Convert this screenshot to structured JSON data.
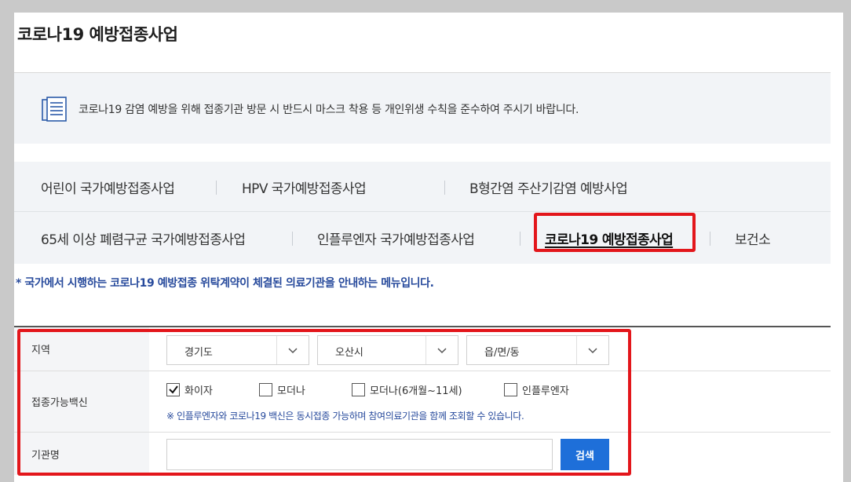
{
  "page": {
    "title": "코로나19 예방접종사업"
  },
  "notice": {
    "icon": "document-list-icon",
    "text": "코로나19 감염 예방을 위해 접종기관 방문 시 반드시 마스크 착용 등 개인위생 수칙을 준수하여 주시기 바랍니다."
  },
  "tabs": {
    "row1": [
      {
        "label": "어린이 국가예방접종사업"
      },
      {
        "label": "HPV 국가예방접종사업"
      },
      {
        "label": "B형간염 주산기감염 예방사업"
      }
    ],
    "row2": [
      {
        "label": "65세 이상 폐렴구균 국가예방접종사업"
      },
      {
        "label": "인플루엔자 국가예방접종사업"
      },
      {
        "label": "코로나19 예방접종사업",
        "active": true
      },
      {
        "label": "보건소"
      }
    ]
  },
  "info_line": "* 국가에서 시행하는 코로나19 예방접종 위탁계약이 체결된 의료기관을 안내하는 메뉴입니다.",
  "form": {
    "region": {
      "label": "지역",
      "province": "경기도",
      "city": "오산시",
      "town": "읍/면/동"
    },
    "vaccine": {
      "label": "접종가능백신",
      "options": [
        {
          "label": "화이자",
          "checked": true
        },
        {
          "label": "모더나",
          "checked": false
        },
        {
          "label": "모더나(6개월~11세)",
          "checked": false
        },
        {
          "label": "인플루엔자",
          "checked": false
        }
      ],
      "note": "※ 인플루엔자와 코로나19 백신은 동시접종 가능하며 참여의료기관을 함께 조회할 수 있습니다."
    },
    "org": {
      "label": "기관명",
      "value": "",
      "placeholder": "",
      "search_label": "검색"
    }
  },
  "colors": {
    "highlight_frame": "#e3161b",
    "accent_blue": "#274a9c",
    "button_blue": "#1e6fd9"
  }
}
